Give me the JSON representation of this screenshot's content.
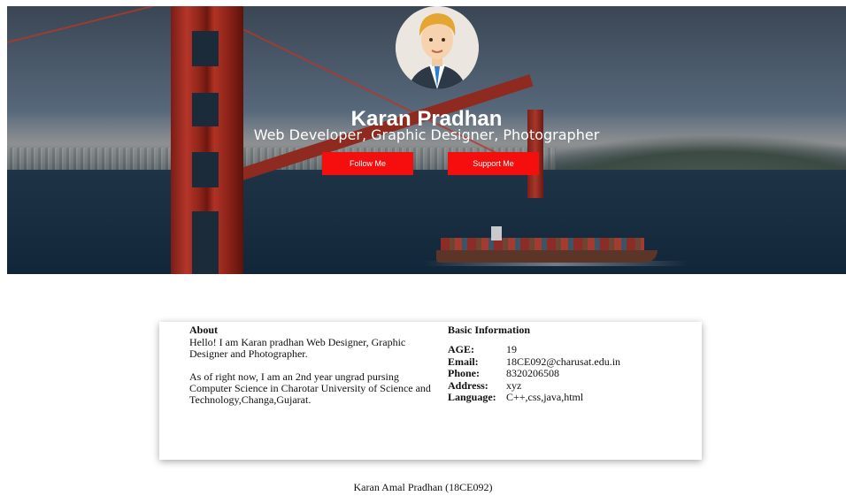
{
  "hero": {
    "name": "Karan Pradhan",
    "subtitle": "Web Developer, Graphic Designer, Photographer",
    "follow_label": "Follow Me",
    "support_label": "Support Me",
    "button_color": "#f40e0e"
  },
  "about": {
    "title": "About",
    "paragraph1": "Hello! I am Karan pradhan Web Designer, Graphic Designer and Photographer.",
    "paragraph2": "As of right now, I am an 2nd year ungrad pursing Computer Science in Charotar University of Science and Technology,Changa,Gujarat."
  },
  "basic": {
    "title": "Basic Information",
    "rows": [
      {
        "label": "AGE:",
        "value": "19"
      },
      {
        "label": "Email:",
        "value": "18CE092@charusat.edu.in"
      },
      {
        "label": "Phone:",
        "value": "8320206508"
      },
      {
        "label": "Address:",
        "value": "xyz"
      },
      {
        "label": "Language:",
        "value": "C++,css,java,html"
      }
    ]
  },
  "footer": {
    "text": "Karan Amal Pradhan (18CE092)"
  }
}
